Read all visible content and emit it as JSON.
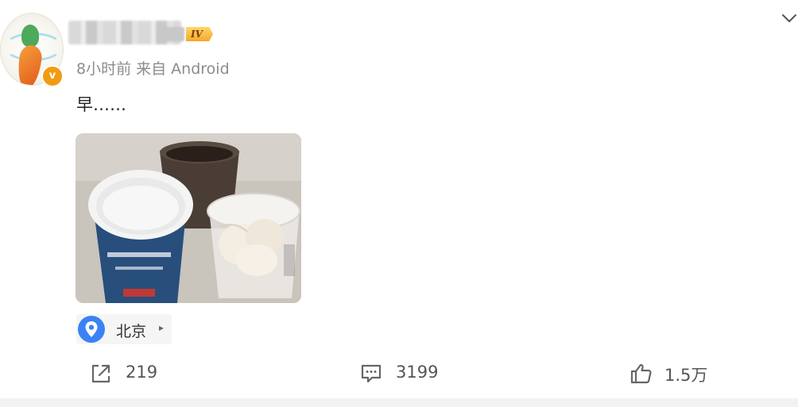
{
  "post": {
    "username": "",
    "level_badge": "IV",
    "verified_badge": "v",
    "meta": "8小时前  来自 Android",
    "text": "早……",
    "photo_icon": "photo-breakfast-yogurt-coffee",
    "location": {
      "label": "北京",
      "icon": "location-pin-icon",
      "arrow": "▸"
    },
    "actions": {
      "repost": {
        "icon": "repost-icon",
        "count": "219"
      },
      "comment": {
        "icon": "comment-icon",
        "count": "3199"
      },
      "like": {
        "icon": "thumbs-up-icon",
        "count": "1.5万"
      }
    },
    "colors": {
      "accent_blue": "#3b82f6",
      "verified_orange": "#f29b12",
      "meta_gray": "#8c8c8c"
    }
  }
}
